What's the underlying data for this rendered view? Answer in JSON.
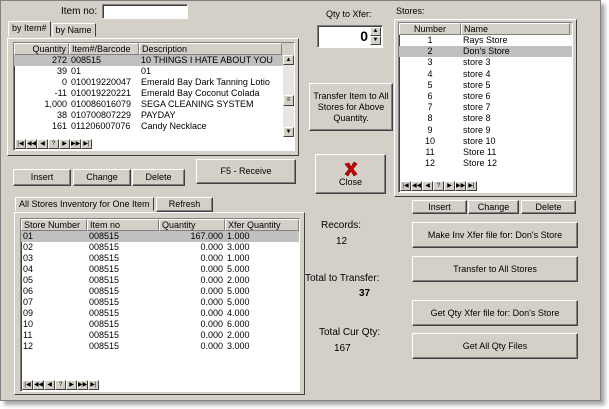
{
  "item_no": {
    "label": "Item no:",
    "value": ""
  },
  "qty_xfer": {
    "label": "Qty to Xfer:",
    "value": "0"
  },
  "item_tabs": [
    {
      "label": "by Item#"
    },
    {
      "label": "by Name"
    }
  ],
  "item_grid": {
    "columns": [
      "Quantity",
      "Item#/Barcode",
      "Description"
    ],
    "rows": [
      {
        "qty": "272",
        "barcode": "008515",
        "desc": "10 THINGS I HATE ABOUT YOU"
      },
      {
        "qty": "39",
        "barcode": "01",
        "desc": "01"
      },
      {
        "qty": "0",
        "barcode": "010019220047",
        "desc": "Emerald Bay Dark Tanning Lotio"
      },
      {
        "qty": "-11",
        "barcode": "010019220221",
        "desc": "Emerald Bay Coconut Colada"
      },
      {
        "qty": "1,000",
        "barcode": "010086016079",
        "desc": "SEGA CLEANING SYSTEM"
      },
      {
        "qty": "38",
        "barcode": "010700807229",
        "desc": "PAYDAY"
      },
      {
        "qty": "161",
        "barcode": "011206007076",
        "desc": "Candy Necklace"
      }
    ]
  },
  "nav_glyphs": [
    "|◀",
    "◀◀",
    "◀",
    "?",
    "▶",
    "▶▶",
    "▶|"
  ],
  "item_buttons": {
    "insert": "Insert",
    "change": "Change",
    "delete": "Delete"
  },
  "transfer_all_qty": "Transfer Item to All Stores for Above Quantity.",
  "f5_receive": "F5 - Receive",
  "close": "Close",
  "stores": {
    "label": "Stores:",
    "columns": [
      "Number",
      "Name"
    ],
    "rows": [
      {
        "num": "1",
        "name": "Rays Store"
      },
      {
        "num": "2",
        "name": "Don's Store"
      },
      {
        "num": "3",
        "name": "store 3"
      },
      {
        "num": "4",
        "name": "store 4"
      },
      {
        "num": "5",
        "name": "store 5"
      },
      {
        "num": "6",
        "name": "store 6"
      },
      {
        "num": "7",
        "name": "store 7"
      },
      {
        "num": "8",
        "name": "store 8"
      },
      {
        "num": "9",
        "name": "store 9"
      },
      {
        "num": "10",
        "name": "store 10"
      },
      {
        "num": "11",
        "name": "Store 11"
      },
      {
        "num": "12",
        "name": "Store 12"
      }
    ],
    "selected_index": 1
  },
  "store_buttons": {
    "insert": "Insert",
    "change": "Change",
    "delete": "Delete"
  },
  "inv_tab": "All Stores Inventory for One Item",
  "refresh": "Refresh",
  "inv_grid": {
    "columns": [
      "Store Number",
      "Item no",
      "Quantity",
      "Xfer Quantity"
    ],
    "rows": [
      {
        "store": "01",
        "item": "008515",
        "qty": "167.000",
        "xfer": "1.000"
      },
      {
        "store": "02",
        "item": "008515",
        "qty": "0.000",
        "xfer": "3.000"
      },
      {
        "store": "03",
        "item": "008515",
        "qty": "0.000",
        "xfer": "1.000"
      },
      {
        "store": "04",
        "item": "008515",
        "qty": "0.000",
        "xfer": "5.000"
      },
      {
        "store": "05",
        "item": "008515",
        "qty": "0.000",
        "xfer": "2.000"
      },
      {
        "store": "06",
        "item": "008515",
        "qty": "0.000",
        "xfer": "5.000"
      },
      {
        "store": "07",
        "item": "008515",
        "qty": "0.000",
        "xfer": "5.000"
      },
      {
        "store": "09",
        "item": "008515",
        "qty": "0.000",
        "xfer": "4.000"
      },
      {
        "store": "10",
        "item": "008515",
        "qty": "0.000",
        "xfer": "6.000"
      },
      {
        "store": "11",
        "item": "008515",
        "qty": "0.000",
        "xfer": "2.000"
      },
      {
        "store": "12",
        "item": "008515",
        "qty": "0.000",
        "xfer": "3.000"
      }
    ]
  },
  "records": {
    "label": "Records:",
    "value": "12"
  },
  "total_transfer": {
    "label": "Total to Transfer:",
    "value": "37"
  },
  "total_cur_qty": {
    "label": "Total Cur Qty:",
    "value": "167"
  },
  "actions": {
    "make_inv": "Make Inv Xfer file for: Don's Store",
    "transfer_all": "Transfer to All Stores",
    "get_qty": "Get Qty Xfer file for: Don's Store",
    "get_all": "Get All Qty Files"
  },
  "colors": {
    "window_bg": "#d4d0c8",
    "selected_row": "#c0c0c0",
    "close_x": "#cc0000"
  }
}
